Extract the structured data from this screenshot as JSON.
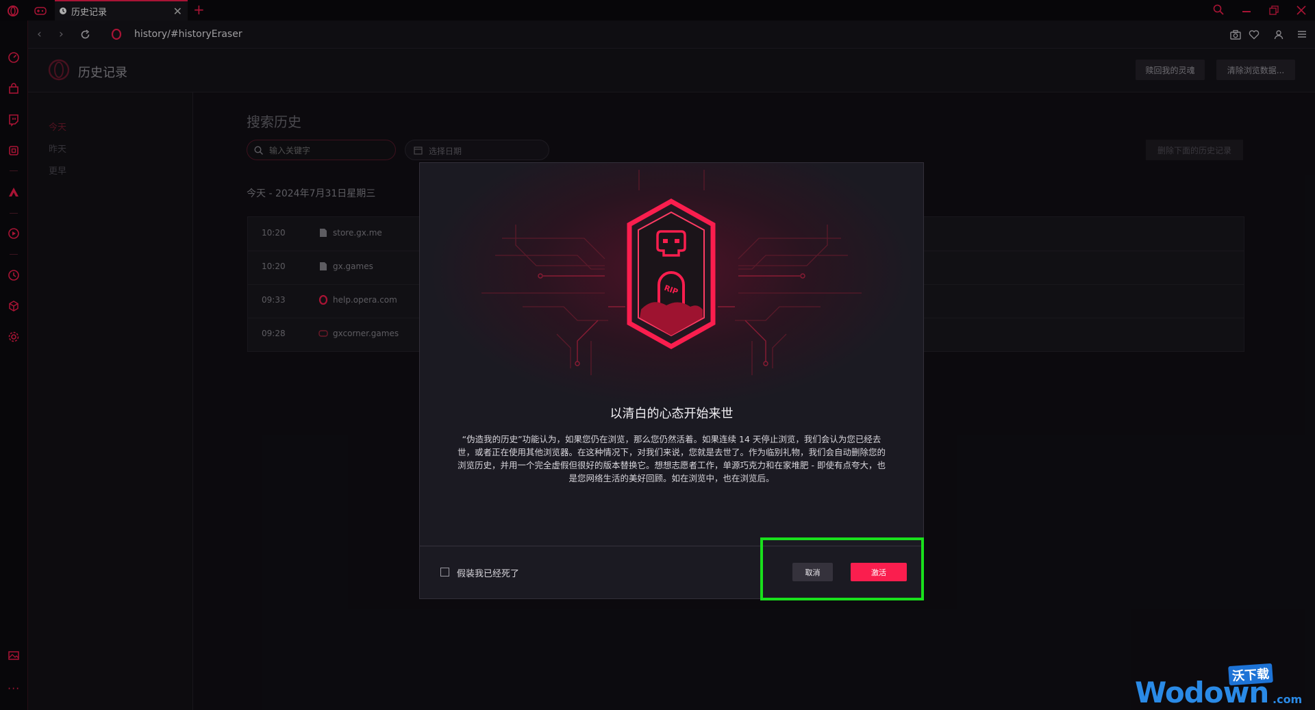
{
  "tab": {
    "title": "历史记录"
  },
  "address": {
    "url": "history/#historyEraser"
  },
  "header": {
    "title": "历史记录",
    "redeem_soul": "赎回我的灵魂",
    "clear_data": "清除浏览数据..."
  },
  "leftnav": {
    "today": "今天",
    "yesterday": "昨天",
    "earlier": "更早"
  },
  "search": {
    "title": "搜索历史",
    "placeholder": "输入关键字",
    "date_placeholder": "选择日期",
    "delete_below": "删除下面的历史记录"
  },
  "history": {
    "date_header": "今天 - 2024年7月31日星期三",
    "rows": [
      {
        "time": "10:20",
        "site": "store.gx.me",
        "icon": "page-icon"
      },
      {
        "time": "10:20",
        "site": "gx.games",
        "icon": "page-icon"
      },
      {
        "time": "09:33",
        "site": "help.opera.com",
        "icon": "opera-icon"
      },
      {
        "time": "09:28",
        "site": "gxcorner.games",
        "icon": "gamepad-icon"
      }
    ]
  },
  "modal": {
    "title": "以清白的心态开始来世",
    "body": "“伪造我的历史”功能认为，如果您仍在浏览，那么您仍然活着。如果连续 14 天停止浏览，我们会认为您已经去世，或者正在使用其他浏览器。在这种情况下，对我们来说，您就是去世了。作为临别礼物，我们会自动删除您的浏览历史，并用一个完全虚假但很好的版本替换它。想想志愿者工作，单源巧克力和在家堆肥 - 即使有点夸大，也是您网络生活的美好回顾。如在浏览中，也在浏览后。",
    "badge_text": "RIP",
    "checkbox_label": "假装我已经死了",
    "cancel": "取消",
    "activate": "激活"
  },
  "watermark": {
    "brand": "Wodown",
    "suffix": ".com",
    "cn": "沃下载"
  },
  "colors": {
    "accent": "#fa1e4e",
    "highlight": "#19e01c",
    "bg": "#121016"
  }
}
